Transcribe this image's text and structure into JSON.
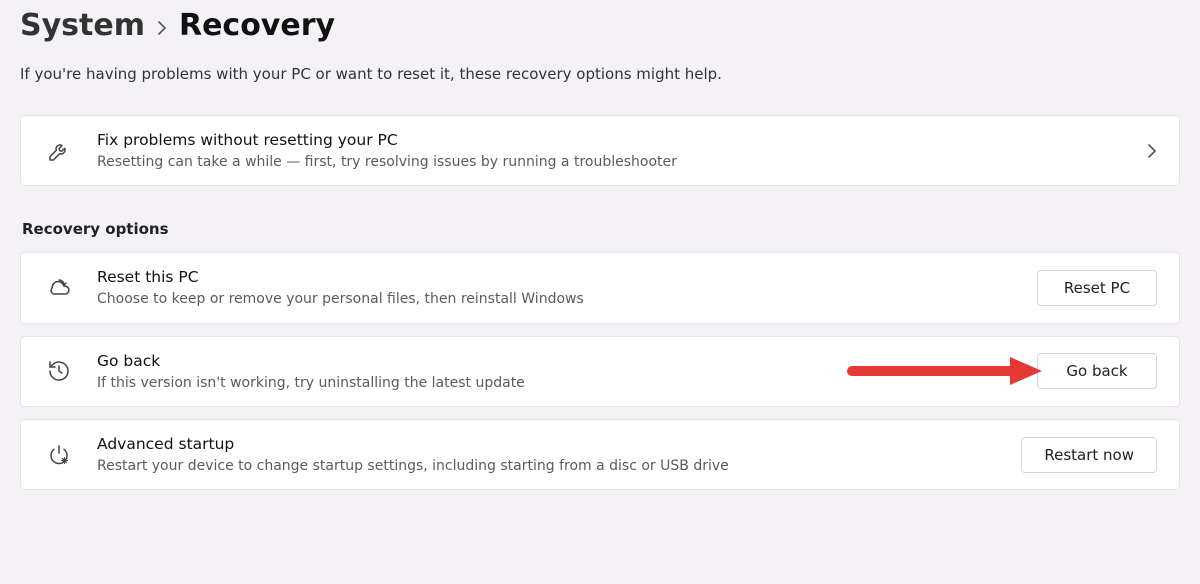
{
  "breadcrumb": {
    "parent": "System",
    "current": "Recovery"
  },
  "intro": "If you're having problems with your PC or want to reset it, these recovery options might help.",
  "top_card": {
    "title": "Fix problems without resetting your PC",
    "sub": "Resetting can take a while — first, try resolving issues by running a troubleshooter"
  },
  "section_head": "Recovery options",
  "options": [
    {
      "title": "Reset this PC",
      "sub": "Choose to keep or remove your personal files, then reinstall Windows",
      "button": "Reset PC"
    },
    {
      "title": "Go back",
      "sub": "If this version isn't working, try uninstalling the latest update",
      "button": "Go back"
    },
    {
      "title": "Advanced startup",
      "sub": "Restart your device to change startup settings, including starting from a disc or USB drive",
      "button": "Restart now"
    }
  ]
}
